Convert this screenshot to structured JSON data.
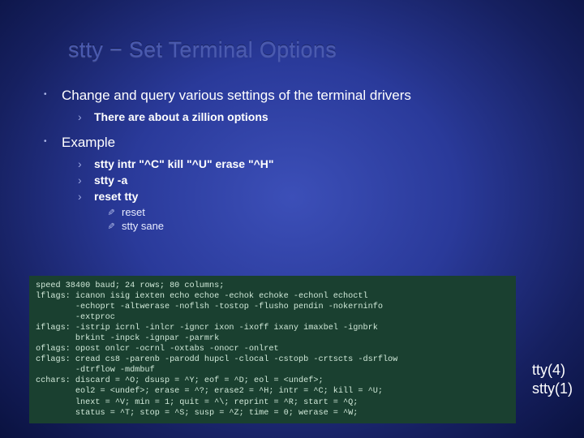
{
  "title": "stty − Set Terminal Options",
  "bullets": {
    "b1a": "Change and query various settings of the terminal drivers",
    "b2a": "There are about a zillion options",
    "b1b": "Example",
    "b2b": "stty intr \"^C\" kill \"^U\" erase \"^H\"",
    "b2c": "stty -a",
    "b2d": "reset tty",
    "b3a": "reset",
    "b3b": "stty sane"
  },
  "terminal": "speed 38400 baud; 24 rows; 80 columns;\nlflags: icanon isig iexten echo echoe -echok echoke -echonl echoctl\n        -echoprt -altwerase -noflsh -tostop -flusho pendin -nokerninfo\n        -extproc\niflags: -istrip icrnl -inlcr -igncr ixon -ixoff ixany imaxbel -ignbrk\n        brkint -inpck -ignpar -parmrk\noflags: opost onlcr -ocrnl -oxtabs -onocr -onlret\ncflags: cread cs8 -parenb -parodd hupcl -clocal -cstopb -crtscts -dsrflow\n        -dtrflow -mdmbuf\ncchars: discard = ^O; dsusp = ^Y; eof = ^D; eol = <undef>;\n        eol2 = <undef>; erase = ^?; erase2 = ^H; intr = ^C; kill = ^U;\n        lnext = ^V; min = 1; quit = ^\\; reprint = ^R; start = ^Q;\n        status = ^T; stop = ^S; susp = ^Z; time = 0; werase = ^W;",
  "refs": {
    "r1": "tty(4)",
    "r2": "stty(1)"
  }
}
